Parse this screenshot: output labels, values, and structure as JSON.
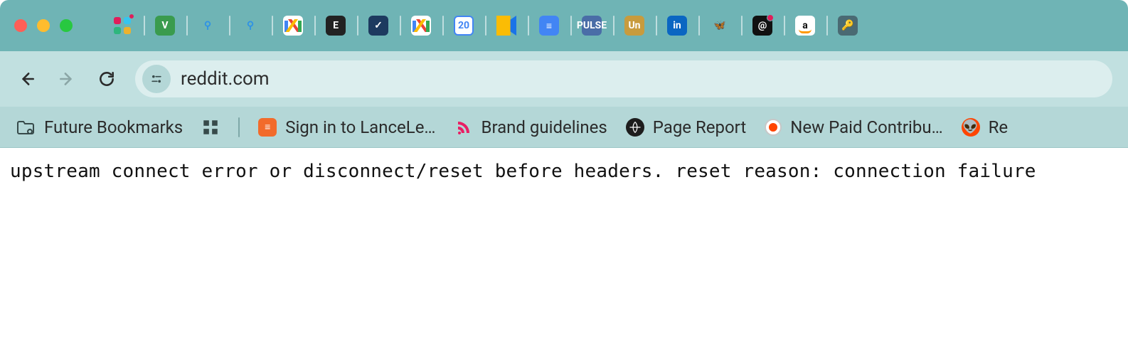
{
  "title_bar": {
    "apps": [
      {
        "name": "slack"
      },
      {
        "name": "v"
      },
      {
        "name": "venus-1"
      },
      {
        "name": "venus-2"
      },
      {
        "name": "gmail-1"
      },
      {
        "name": "e"
      },
      {
        "name": "check"
      },
      {
        "name": "gmail-2"
      },
      {
        "name": "calendar",
        "label": "20"
      },
      {
        "name": "meet"
      },
      {
        "name": "docs"
      },
      {
        "name": "pulse",
        "label": "PULSE"
      },
      {
        "name": "un",
        "label": "Un"
      },
      {
        "name": "linkedin",
        "label": "in"
      },
      {
        "name": "bluesky"
      },
      {
        "name": "threads"
      },
      {
        "name": "amazon",
        "label": "a"
      },
      {
        "name": "key"
      }
    ]
  },
  "address_bar": {
    "url": "reddit.com"
  },
  "bookmarks": {
    "folder_label": "Future Bookmarks",
    "items": [
      {
        "label": "Sign in to LanceLe…"
      },
      {
        "label": "Brand guidelines"
      },
      {
        "label": "Page Report"
      },
      {
        "label": "New Paid Contribu…"
      },
      {
        "label": "Re"
      }
    ]
  },
  "page": {
    "body_text": "upstream connect error or disconnect/reset before headers. reset reason: connection failure"
  }
}
